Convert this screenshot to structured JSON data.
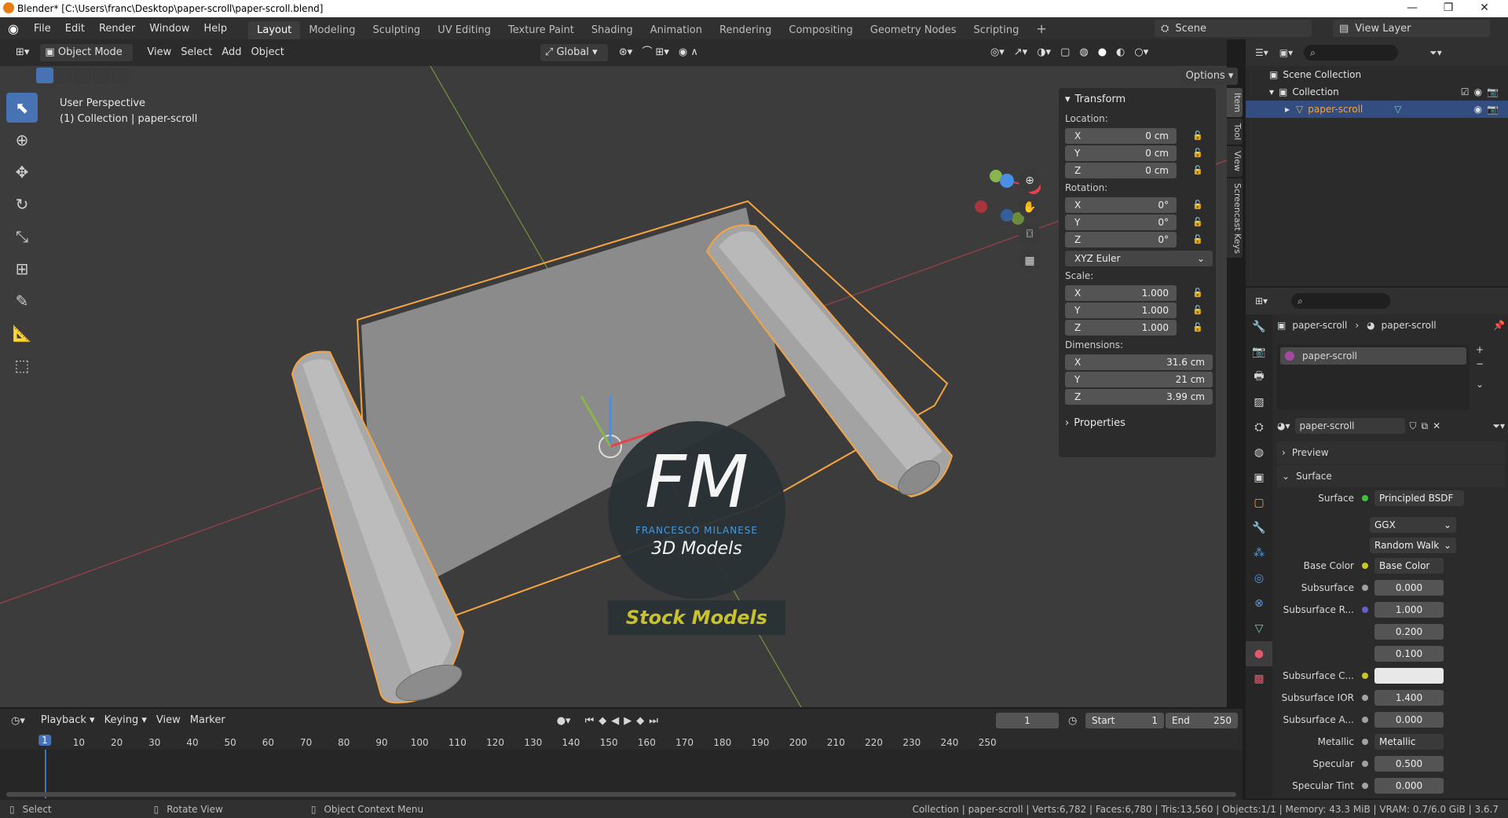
{
  "window": {
    "title": "Blender* [C:\\Users\\franc\\Desktop\\paper-scroll\\paper-scroll.blend]",
    "minimize": "—",
    "maximize": "❐",
    "close": "✕"
  },
  "menu": {
    "items": [
      "File",
      "Edit",
      "Render",
      "Window",
      "Help"
    ]
  },
  "workspaces": [
    "Layout",
    "Modeling",
    "Sculpting",
    "UV Editing",
    "Texture Paint",
    "Shading",
    "Animation",
    "Rendering",
    "Compositing",
    "Geometry Nodes",
    "Scripting"
  ],
  "active_workspace": "Layout",
  "scene": {
    "label": "Scene",
    "view_layer": "View Layer"
  },
  "viewport_header": {
    "mode": "Object Mode",
    "menus": [
      "View",
      "Select",
      "Add",
      "Object"
    ],
    "orientation": "Global",
    "options": "Options"
  },
  "viewport": {
    "perspective": "User Perspective",
    "collection_info": "(1) Collection | paper-scroll"
  },
  "watermark": {
    "letters": "FM",
    "name": "FRANCESCO MILANESE",
    "sub": "3D Models",
    "banner": "Stock Models"
  },
  "npanel": {
    "title": "Transform",
    "location_label": "Location:",
    "location": [
      {
        "axis": "X",
        "value": "0 cm"
      },
      {
        "axis": "Y",
        "value": "0 cm"
      },
      {
        "axis": "Z",
        "value": "0 cm"
      }
    ],
    "rotation_label": "Rotation:",
    "rotation": [
      {
        "axis": "X",
        "value": "0°"
      },
      {
        "axis": "Y",
        "value": "0°"
      },
      {
        "axis": "Z",
        "value": "0°"
      }
    ],
    "rotation_mode": "XYZ Euler",
    "scale_label": "Scale:",
    "scale": [
      {
        "axis": "X",
        "value": "1.000"
      },
      {
        "axis": "Y",
        "value": "1.000"
      },
      {
        "axis": "Z",
        "value": "1.000"
      }
    ],
    "dimensions_label": "Dimensions:",
    "dimensions": [
      {
        "axis": "X",
        "value": "31.6 cm"
      },
      {
        "axis": "Y",
        "value": "21 cm"
      },
      {
        "axis": "Z",
        "value": "3.99 cm"
      }
    ],
    "properties": "Properties",
    "tabs": [
      "Item",
      "Tool",
      "View",
      "Screencast Keys"
    ]
  },
  "outliner": {
    "scene_collection": "Scene Collection",
    "collection": "Collection",
    "object": "paper-scroll"
  },
  "properties": {
    "breadcrumb_obj": "paper-scroll",
    "breadcrumb_mat": "paper-scroll",
    "slot": "paper-scroll",
    "material": "paper-scroll",
    "preview": "Preview",
    "surface_section": "Surface",
    "surface_label": "Surface",
    "surface_value": "Principled BSDF",
    "distribution": "GGX",
    "subsurface_method": "Random Walk",
    "rows": [
      {
        "label": "Base Color",
        "value": "Base Color",
        "socket": "#c7c729",
        "type": "link"
      },
      {
        "label": "Subsurface",
        "value": "0.000",
        "socket": "#a1a1a1",
        "type": "num"
      },
      {
        "label": "Subsurface R...",
        "value": "1.000",
        "socket": "#6363c7",
        "type": "num"
      },
      {
        "label": "",
        "value": "0.200",
        "socket": "",
        "type": "num"
      },
      {
        "label": "",
        "value": "0.100",
        "socket": "",
        "type": "num"
      },
      {
        "label": "Subsurface C...",
        "value": "",
        "socket": "#c7c729",
        "type": "color"
      },
      {
        "label": "Subsurface IOR",
        "value": "1.400",
        "socket": "#a1a1a1",
        "type": "num"
      },
      {
        "label": "Subsurface A...",
        "value": "0.000",
        "socket": "#a1a1a1",
        "type": "num"
      },
      {
        "label": "Metallic",
        "value": "Metallic",
        "socket": "#a1a1a1",
        "type": "link"
      },
      {
        "label": "Specular",
        "value": "0.500",
        "socket": "#a1a1a1",
        "type": "num"
      },
      {
        "label": "Specular Tint",
        "value": "0.000",
        "socket": "#a1a1a1",
        "type": "num"
      }
    ]
  },
  "timeline": {
    "menus": [
      "Playback",
      "Keying",
      "View",
      "Marker"
    ],
    "current_frame": "1",
    "start_label": "Start",
    "start": "1",
    "end_label": "End",
    "end": "250",
    "ticks": [
      "1",
      "10",
      "20",
      "30",
      "40",
      "50",
      "60",
      "70",
      "80",
      "90",
      "100",
      "110",
      "120",
      "130",
      "140",
      "150",
      "160",
      "170",
      "180",
      "190",
      "200",
      "210",
      "220",
      "230",
      "240",
      "250"
    ]
  },
  "statusbar": {
    "select": "Select",
    "rotate": "Rotate View",
    "context": "Object Context Menu",
    "stats": "Collection | paper-scroll | Verts:6,782 | Faces:6,780 | Tris:13,560 | Objects:1/1 | Memory: 43.3 MiB | VRAM: 0.7/6.0 GiB | 3.6.7"
  },
  "colors": {
    "accent": "#4772b3",
    "selection": "#f5a442",
    "x_axis": "#e2424e",
    "y_axis": "#8ab54d",
    "z_axis": "#4a8fe3"
  }
}
